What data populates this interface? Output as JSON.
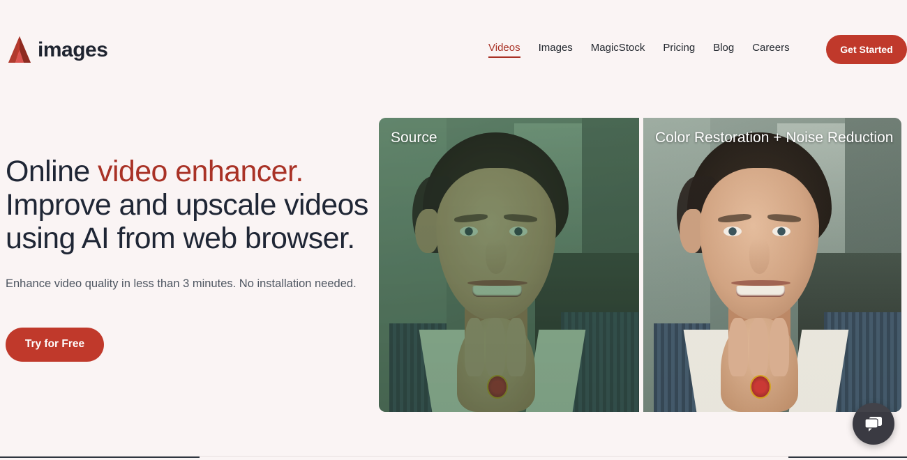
{
  "brand": {
    "logo_icon": "triangle-a-logo-icon",
    "name": "images",
    "logo_color": "#b03a2e"
  },
  "nav": {
    "items": [
      {
        "label": "Videos",
        "active": true
      },
      {
        "label": "Images",
        "active": false
      },
      {
        "label": "MagicStock",
        "active": false
      },
      {
        "label": "Pricing",
        "active": false
      },
      {
        "label": "Blog",
        "active": false
      },
      {
        "label": "Careers",
        "active": false
      }
    ],
    "cta_label": "Get Started",
    "cta_color": "#c0392b",
    "active_color": "#a93226"
  },
  "hero": {
    "headline_part1": "Online ",
    "headline_accent": "video enhancer.",
    "headline_part2": " Improve and upscale videos using AI from web browser.",
    "subhead": "Enhance video quality in less than 3 minutes. No installation needed.",
    "cta_label": "Try for Free",
    "cta_color": "#c0392b",
    "accent_color": "#a93226",
    "text_color": "#1f2635"
  },
  "comparison": {
    "source_label": "Source",
    "result_label": "Color Restoration + Noise Reduction"
  },
  "chat": {
    "icon": "chat-bubble-icon",
    "background_color": "#3a3a42"
  },
  "page": {
    "background_color": "#faf4f4"
  }
}
